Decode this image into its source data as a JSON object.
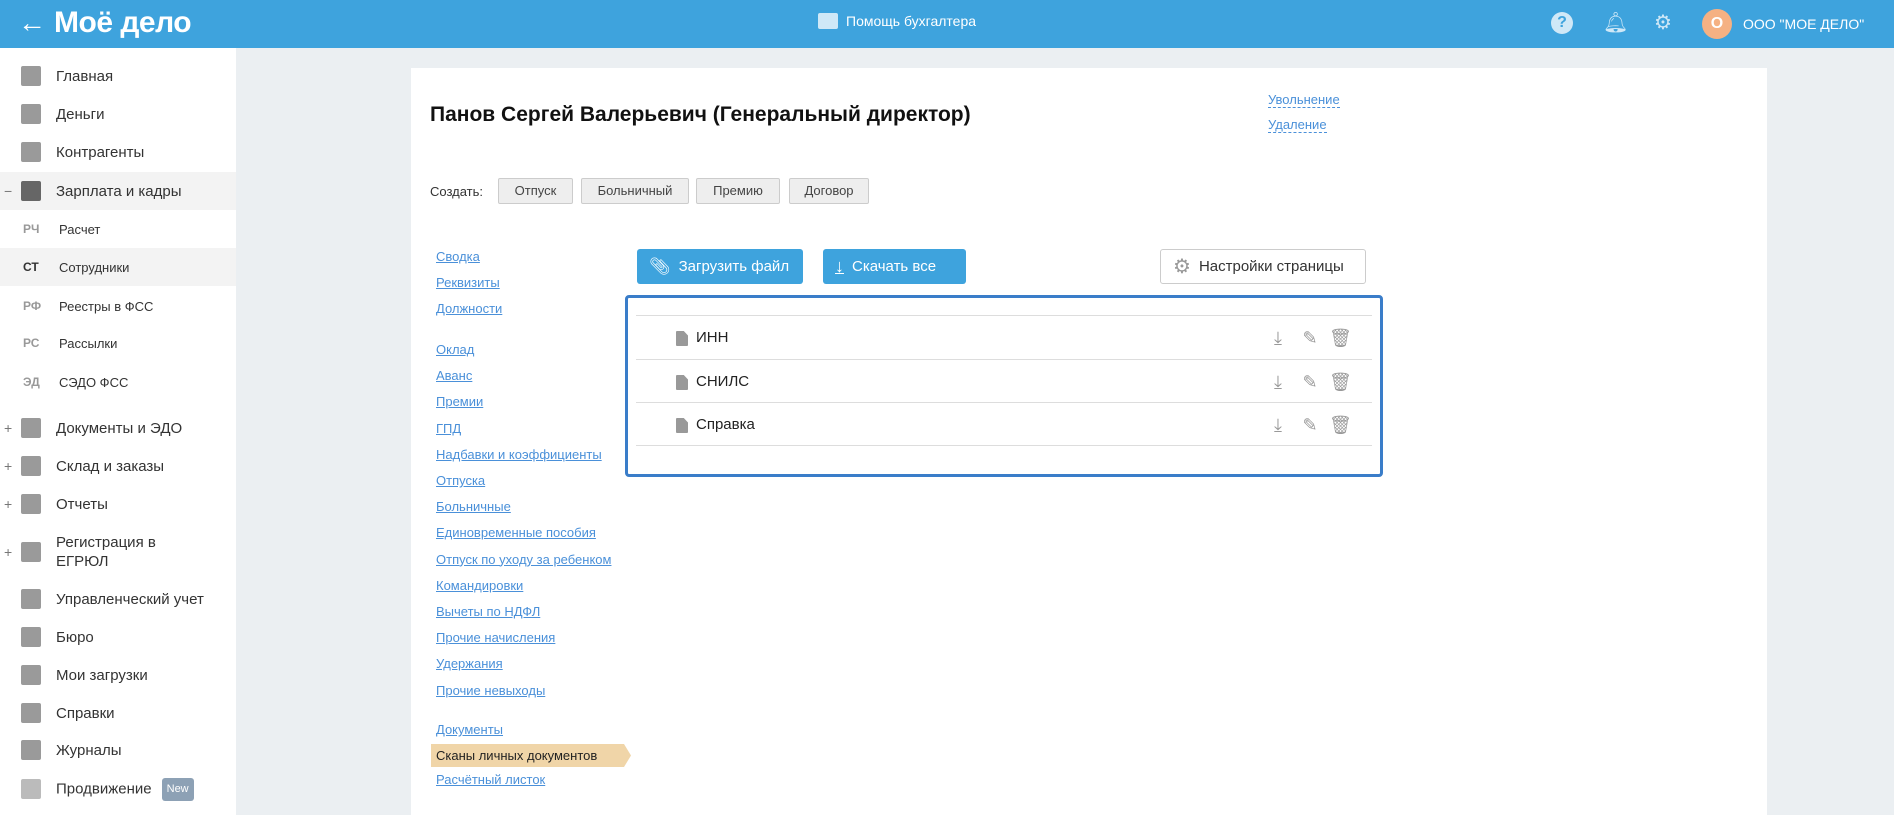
{
  "header": {
    "logo": "Моё дело",
    "help_center": "Помощь бухгалтера",
    "avatar_letter": "О",
    "org_name": "ООО \"МОЕ ДЕЛО\""
  },
  "sidebar": {
    "items": [
      {
        "label": "Главная"
      },
      {
        "label": "Деньги"
      },
      {
        "label": "Контрагенты"
      },
      {
        "label": "Зарплата и кадры"
      }
    ],
    "sub_items": [
      {
        "abbr": "РЧ",
        "label": "Расчет"
      },
      {
        "abbr": "СТ",
        "label": "Сотрудники"
      },
      {
        "abbr": "РФ",
        "label": "Реестры в ФСС"
      },
      {
        "abbr": "РС",
        "label": "Рассылки"
      },
      {
        "abbr": "ЭД",
        "label": "СЭДО ФСС"
      }
    ],
    "items2": [
      {
        "label": "Документы и ЭДО"
      },
      {
        "label": "Склад и заказы"
      },
      {
        "label": "Отчеты"
      },
      {
        "label": "Регистрация в ЕГРЮЛ"
      },
      {
        "label": "Управленческий учет"
      },
      {
        "label": "Бюро"
      },
      {
        "label": "Мои загрузки"
      },
      {
        "label": "Справки"
      },
      {
        "label": "Журналы"
      },
      {
        "label": "Продвижение",
        "badge": "New"
      }
    ]
  },
  "employee": {
    "title": "Панов Сергей Валерьевич (Генеральный директор)",
    "dismiss": "Увольнение",
    "delete": "Удаление"
  },
  "create": {
    "label": "Создать:",
    "buttons": [
      "Отпуск",
      "Больничный",
      "Премию",
      "Договор"
    ]
  },
  "nav": {
    "group1": [
      "Сводка",
      "Реквизиты",
      "Должности"
    ],
    "group2": [
      "Оклад",
      "Аванс",
      "Премии",
      "ГПД",
      "Надбавки и коэффициенты",
      "Отпуска",
      "Больничные",
      "Единовременные пособия",
      "Отпуск по уходу за ребенком",
      "Командировки",
      "Вычеты по НДФЛ",
      "Прочие начисления",
      "Удержания",
      "Прочие невыходы"
    ],
    "group3_before": "Документы",
    "active": "Сканы личных документов",
    "group3_after": "Расчётный листок"
  },
  "toolbar": {
    "upload": "Загрузить файл",
    "download_all": "Скачать все",
    "settings": "Настройки страницы"
  },
  "files": [
    {
      "name": "ИНН"
    },
    {
      "name": "СНИЛС"
    },
    {
      "name": "Справка"
    }
  ]
}
